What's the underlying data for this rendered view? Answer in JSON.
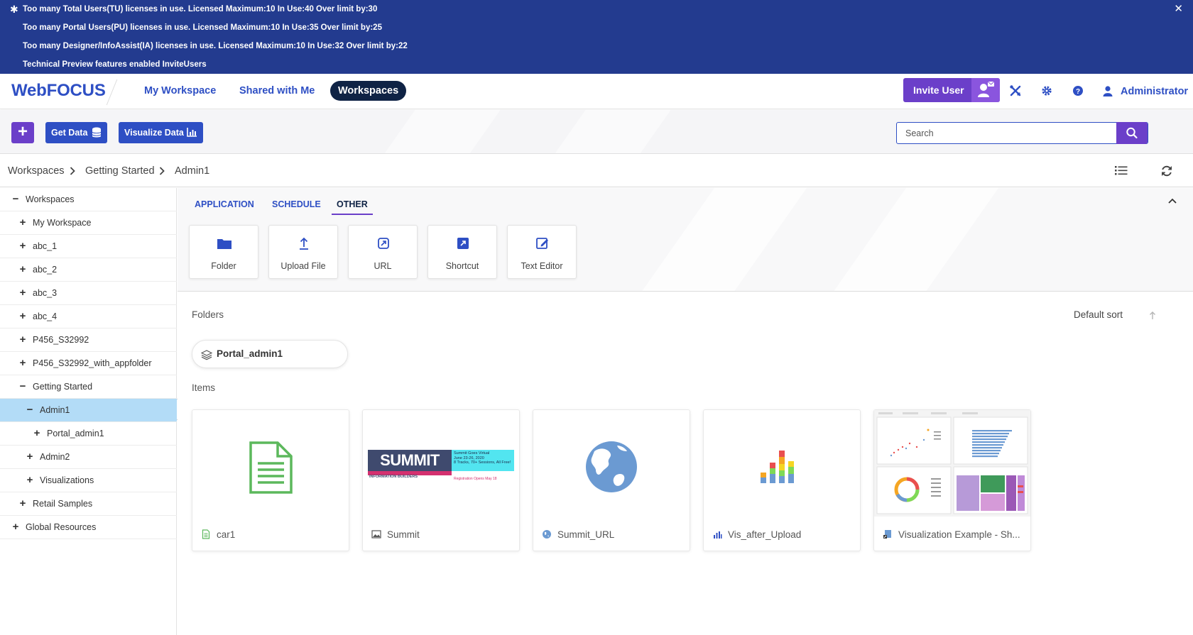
{
  "banner": {
    "lines": [
      "Too many Total Users(TU) licenses in use. Licensed Maximum:10 In Use:40 Over limit by:30",
      "Too many Portal Users(PU) licenses in use. Licensed Maximum:10 In Use:35 Over limit by:25",
      "Too many Designer/InfoAssist(IA) licenses in use. Licensed Maximum:10 In Use:32 Over limit by:22",
      "Technical Preview features enabled InviteUsers"
    ],
    "star": "✱",
    "close": "✕"
  },
  "header": {
    "brand": "WebFOCUS",
    "tabs": [
      "My Workspace",
      "Shared with Me",
      "Workspaces"
    ],
    "invite_label": "Invite User",
    "user": "Administrator"
  },
  "toolbar": {
    "plus": "+",
    "get_data": "Get Data",
    "visualize_data": "Visualize Data",
    "search_placeholder": "Search"
  },
  "breadcrumb": [
    "Workspaces",
    "Getting Started",
    "Admin1"
  ],
  "tree": [
    {
      "label": "Workspaces",
      "toggle": "−"
    },
    {
      "label": "My Workspace",
      "toggle": "+"
    },
    {
      "label": "abc_1",
      "toggle": "+"
    },
    {
      "label": "abc_2",
      "toggle": "+"
    },
    {
      "label": "abc_3",
      "toggle": "+"
    },
    {
      "label": "abc_4",
      "toggle": "+"
    },
    {
      "label": "P456_S32992",
      "toggle": "+"
    },
    {
      "label": "P456_S32992_with_appfolder",
      "toggle": "+"
    },
    {
      "label": "Getting Started",
      "toggle": "−"
    },
    {
      "label": "Admin1",
      "toggle": "−"
    },
    {
      "label": "Portal_admin1",
      "toggle": "+"
    },
    {
      "label": "Admin2",
      "toggle": "+"
    },
    {
      "label": "Visualizations",
      "toggle": "+"
    },
    {
      "label": "Retail Samples",
      "toggle": "+"
    },
    {
      "label": "Global Resources",
      "toggle": "+"
    }
  ],
  "create_tabs": [
    "APPLICATION",
    "SCHEDULE",
    "OTHER"
  ],
  "create_tiles": [
    "Folder",
    "Upload File",
    "URL",
    "Shortcut",
    "Text Editor"
  ],
  "content": {
    "folders_label": "Folders",
    "items_label": "Items",
    "sort_label": "Default sort",
    "folders": [
      "Portal_admin1"
    ],
    "items": [
      "car1",
      "Summit",
      "Summit_URL",
      "Vis_after_Upload",
      "Visualization Example - Sh..."
    ]
  },
  "summit_thumb": {
    "logo": "SUMMIT",
    "sub": "INFORMATION BUILDERS",
    "line1": "Summit Goes Virtual",
    "line2": "June 23-26, 2020",
    "line3": "8 Tracks, 70+ Sessions, All Free!",
    "line4": "Registration Opens May 18"
  },
  "colors": {
    "banner": "#233b8f",
    "primary": "#2e4fc4",
    "purple": "#6b3fc9",
    "selected_row": "#b3dcf7",
    "active_tab": "#0f2345"
  }
}
